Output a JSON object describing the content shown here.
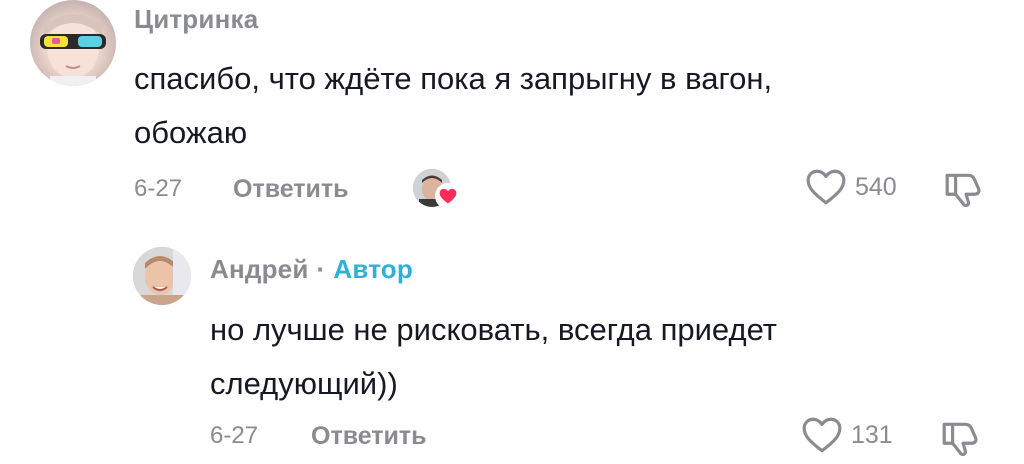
{
  "comments": [
    {
      "username": "Цитринка",
      "text_lines": [
        "спасибо, что ждёте пока я запрыгну в вагон,",
        "обожаю"
      ],
      "date": "6-27",
      "reply_label": "Ответить",
      "likes": "540",
      "creator_liked": true
    },
    {
      "username": "Андрей",
      "separator": "·",
      "author_badge": "Автор",
      "text_lines": [
        "но лучше не рисковать, всегда приедет",
        "следующий))"
      ],
      "date": "6-27",
      "reply_label": "Ответить",
      "likes": "131"
    }
  ],
  "icons": {
    "like": "heart-outline-icon",
    "dislike": "thumbs-down-outline-icon",
    "creator_liked": "creator-heart-badge-icon"
  },
  "colors": {
    "text": "#161823",
    "muted": "#8a8b91",
    "author_badge": "#2fb1d6",
    "heart_badge": "#fe2c55"
  }
}
